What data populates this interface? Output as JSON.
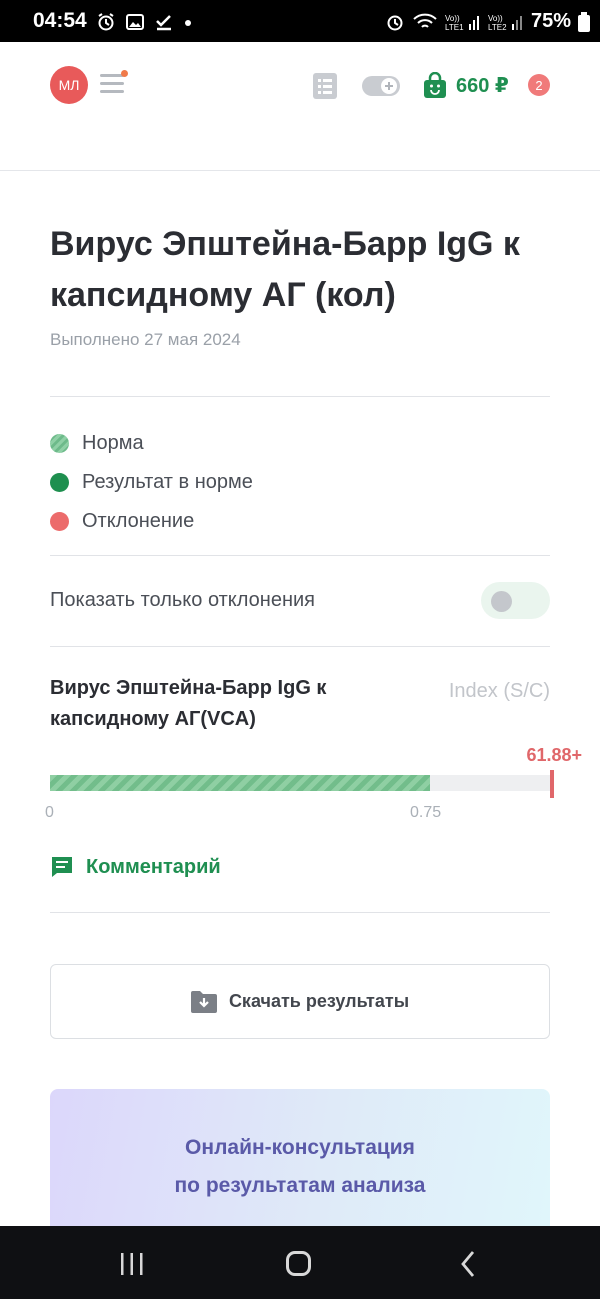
{
  "status_bar": {
    "time": "04:54",
    "battery": "75%"
  },
  "header": {
    "avatar_initials": "МЛ",
    "balance": "660 ₽",
    "cart_count": "2"
  },
  "page": {
    "title": "Вирус Эпштейна-Барр IgG к капсидному АГ (кол)",
    "date": "Выполнено 27 мая 2024"
  },
  "legend": [
    {
      "label": "Норма",
      "kind": "norm"
    },
    {
      "label": "Результат в норме",
      "kind": "ok"
    },
    {
      "label": "Отклонение",
      "kind": "deviation"
    }
  ],
  "filter": {
    "label": "Показать только отклонения",
    "enabled": false
  },
  "test": {
    "name": "Вирус Эпштейна-Барр IgG к капсидному АГ(VCA)",
    "unit": "Index (S/C)",
    "result": "61.88+",
    "norm_min_label": "0",
    "norm_max_label": "0.75",
    "norm_fraction": 0.76,
    "result_fraction": 1.0,
    "comment_label": "Комментарий"
  },
  "download": {
    "label": "Скачать результаты"
  },
  "consultation": {
    "line1": "Онлайн-консультация",
    "line2": "по результатам анализа"
  },
  "colors": {
    "accent_green": "#1f8f51",
    "deviation_red": "#e0676a",
    "avatar_red": "#e85a5a"
  }
}
